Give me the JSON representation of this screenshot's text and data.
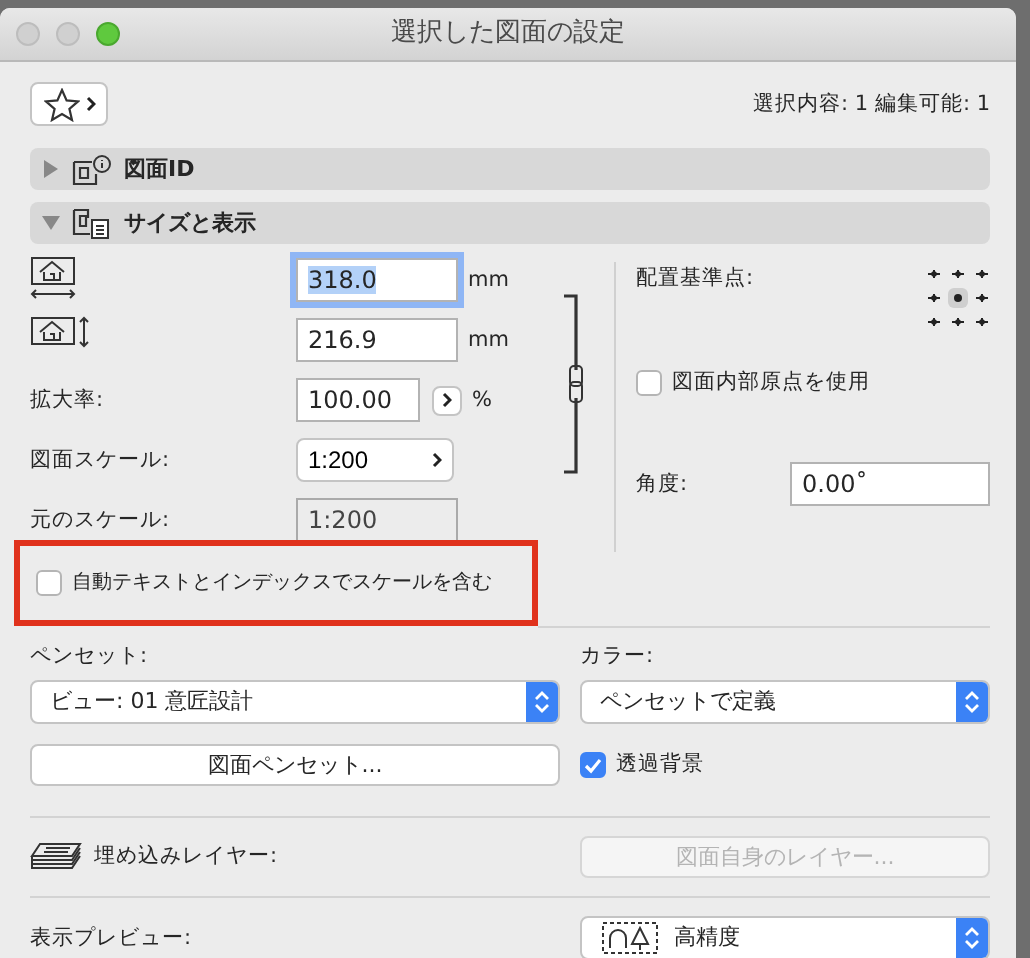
{
  "window": {
    "title": "選択した図面の設定"
  },
  "toolbar": {
    "selection_info": "選択内容: 1 編集可能: 1"
  },
  "sections": [
    {
      "label": "図面ID",
      "expanded": false,
      "kind": "id"
    },
    {
      "label": "サイズと表示",
      "expanded": true,
      "kind": "size"
    }
  ],
  "size": {
    "width": {
      "value": "318.0",
      "unit": "mm",
      "focused": true
    },
    "height": {
      "value": "216.9",
      "unit": "mm",
      "focused": false
    },
    "magnification": {
      "label": "拡大率:",
      "value": "100.00",
      "unit": "%"
    },
    "drawing_scale": {
      "label": "図面スケール:",
      "value": "1:200"
    },
    "original_scale": {
      "label": "元のスケール:",
      "value": "1:200",
      "disabled": true
    },
    "anchor": {
      "label": "配置基準点:"
    },
    "use_internal_origin": {
      "label": "図面内部原点を使用",
      "checked": false
    },
    "angle": {
      "label": "角度:",
      "value": "0.00˚"
    },
    "include_scale": {
      "label": "自動テキストとインデックスでスケールを含む",
      "checked": false,
      "highlighted": true
    }
  },
  "pen_set": {
    "label": "ペンセット:",
    "value": "ビュー: 01 意匠設計"
  },
  "color": {
    "label": "カラー:",
    "value": "ペンセットで定義"
  },
  "pen_set_button": {
    "label": "図面ペンセット..."
  },
  "transparent_background": {
    "label": "透過背景",
    "checked": true
  },
  "embedded_layers": {
    "label": "埋め込みレイヤー:",
    "button": "図面自身のレイヤー...",
    "disabled": true
  },
  "preview": {
    "label": "表示プレビュー:",
    "value": "高精度"
  }
}
